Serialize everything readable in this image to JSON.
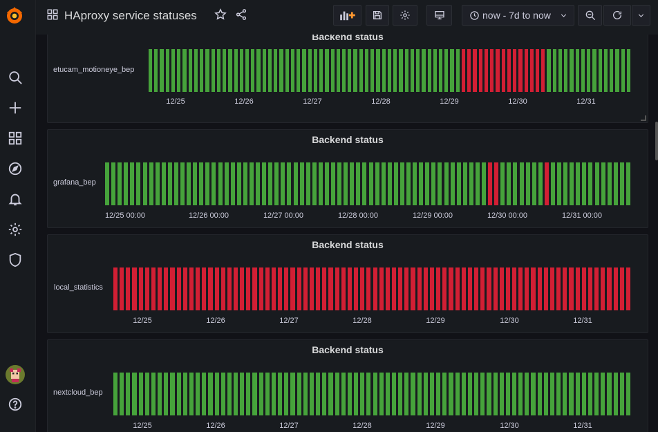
{
  "header": {
    "title": "HAproxy service statuses",
    "time_range": "now - 7d to now"
  },
  "icons": {
    "logo": "grafana-logo",
    "search": "search-icon",
    "create": "plus-icon",
    "dashboards": "dashboards-icon",
    "explore": "compass-icon",
    "alerting": "bell-icon",
    "configuration": "gear-icon",
    "server_admin": "shield-icon",
    "profile": "avatar",
    "help": "help-icon"
  },
  "colors": {
    "ok": "#37872d",
    "down": "#c4162a",
    "bar_fill_ok": "#46a33b",
    "bar_fill_down": "#d21f34"
  },
  "panels": [
    {
      "title": "Backend status",
      "series": "etucam_motioneye_bep",
      "ticks": [
        "12/25",
        "12/26",
        "12/27",
        "12/28",
        "12/29",
        "12/30",
        "12/31"
      ],
      "states": [
        "ok",
        "ok",
        "ok",
        "ok",
        "ok",
        "ok",
        "ok",
        "ok",
        "ok",
        "ok",
        "ok",
        "ok",
        "ok",
        "ok",
        "ok",
        "ok",
        "ok",
        "ok",
        "ok",
        "ok",
        "ok",
        "ok",
        "ok",
        "ok",
        "ok",
        "ok",
        "ok",
        "ok",
        "ok",
        "ok",
        "ok",
        "ok",
        "ok",
        "ok",
        "ok",
        "ok",
        "ok",
        "ok",
        "ok",
        "ok",
        "ok",
        "ok",
        "ok",
        "ok",
        "ok",
        "ok",
        "ok",
        "ok",
        "ok",
        "ok",
        "ok",
        "ok",
        "ok",
        "ok",
        "ok",
        "down",
        "down",
        "down",
        "down",
        "down",
        "down",
        "down",
        "down",
        "down",
        "down",
        "down",
        "down",
        "down",
        "down",
        "down",
        "ok",
        "ok",
        "ok",
        "ok",
        "ok",
        "ok",
        "ok",
        "ok",
        "ok",
        "ok",
        "ok",
        "ok",
        "ok",
        "ok",
        "ok"
      ]
    },
    {
      "title": "Backend status",
      "series": "grafana_bep",
      "ticks": [
        "12/25 00:00",
        "12/26 00:00",
        "12/27 00:00",
        "12/28 00:00",
        "12/29 00:00",
        "12/30 00:00",
        "12/31 00:00"
      ],
      "states": [
        "ok",
        "ok",
        "ok",
        "ok",
        "ok",
        "ok",
        "ok",
        "ok",
        "ok",
        "ok",
        "ok",
        "ok",
        "ok",
        "ok",
        "ok",
        "ok",
        "ok",
        "ok",
        "ok",
        "ok",
        "ok",
        "ok",
        "ok",
        "ok",
        "ok",
        "ok",
        "ok",
        "ok",
        "ok",
        "ok",
        "ok",
        "ok",
        "ok",
        "ok",
        "ok",
        "ok",
        "ok",
        "ok",
        "ok",
        "ok",
        "ok",
        "ok",
        "ok",
        "ok",
        "ok",
        "ok",
        "ok",
        "ok",
        "ok",
        "ok",
        "ok",
        "ok",
        "ok",
        "ok",
        "ok",
        "ok",
        "ok",
        "ok",
        "ok",
        "ok",
        "ok",
        "down",
        "down",
        "ok",
        "ok",
        "ok",
        "ok",
        "ok",
        "ok",
        "ok",
        "down",
        "ok",
        "ok",
        "ok",
        "ok",
        "ok",
        "ok",
        "ok",
        "ok",
        "ok",
        "ok",
        "ok",
        "ok",
        "ok"
      ]
    },
    {
      "title": "Backend status",
      "series": "local_statistics",
      "ticks": [
        "12/25",
        "12/26",
        "12/27",
        "12/28",
        "12/29",
        "12/30",
        "12/31"
      ],
      "states": [
        "down",
        "down",
        "down",
        "down",
        "down",
        "down",
        "down",
        "down",
        "down",
        "down",
        "down",
        "down",
        "down",
        "down",
        "down",
        "down",
        "down",
        "down",
        "down",
        "down",
        "down",
        "down",
        "down",
        "down",
        "down",
        "down",
        "down",
        "down",
        "down",
        "down",
        "down",
        "down",
        "down",
        "down",
        "down",
        "down",
        "down",
        "down",
        "down",
        "down",
        "down",
        "down",
        "down",
        "down",
        "down",
        "down",
        "down",
        "down",
        "down",
        "down",
        "down",
        "down",
        "down",
        "down",
        "down",
        "down",
        "down",
        "down",
        "down",
        "down",
        "down",
        "down",
        "down",
        "down",
        "down",
        "down",
        "down",
        "down",
        "down",
        "down",
        "down",
        "down",
        "down",
        "down",
        "down",
        "down",
        "down",
        "down",
        "down",
        "down",
        "down",
        "down"
      ]
    },
    {
      "title": "Backend status",
      "series": "nextcloud_bep",
      "ticks": [
        "12/25",
        "12/26",
        "12/27",
        "12/28",
        "12/29",
        "12/30",
        "12/31"
      ],
      "states": [
        "ok",
        "ok",
        "ok",
        "ok",
        "ok",
        "ok",
        "ok",
        "ok",
        "ok",
        "ok",
        "ok",
        "ok",
        "ok",
        "ok",
        "ok",
        "ok",
        "ok",
        "ok",
        "ok",
        "ok",
        "ok",
        "ok",
        "ok",
        "ok",
        "ok",
        "ok",
        "ok",
        "ok",
        "ok",
        "ok",
        "ok",
        "ok",
        "ok",
        "ok",
        "ok",
        "ok",
        "ok",
        "ok",
        "ok",
        "ok",
        "ok",
        "ok",
        "ok",
        "ok",
        "ok",
        "ok",
        "ok",
        "ok",
        "ok",
        "ok",
        "ok",
        "ok",
        "ok",
        "ok",
        "ok",
        "ok",
        "ok",
        "ok",
        "ok",
        "ok",
        "ok",
        "ok",
        "ok",
        "ok",
        "ok",
        "ok",
        "ok",
        "ok",
        "ok",
        "ok",
        "ok",
        "ok",
        "ok",
        "ok",
        "ok",
        "ok",
        "ok",
        "ok",
        "ok",
        "ok",
        "ok",
        "ok"
      ]
    }
  ]
}
